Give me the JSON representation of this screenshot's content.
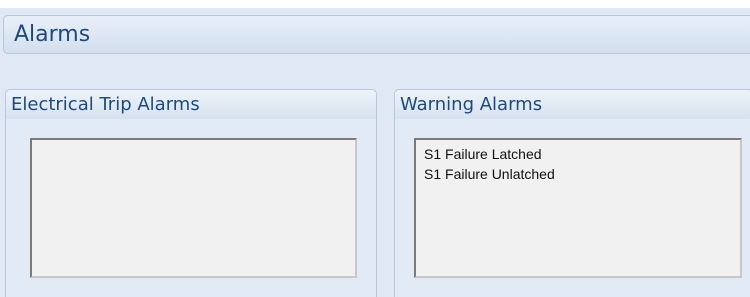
{
  "page": {
    "title": "Alarms"
  },
  "electrical_trip_alarms": {
    "title": "Electrical Trip Alarms",
    "items": []
  },
  "warning_alarms": {
    "title": "Warning Alarms",
    "items": [
      "S1 Failure Latched",
      "S1 Failure Unlatched"
    ]
  }
}
